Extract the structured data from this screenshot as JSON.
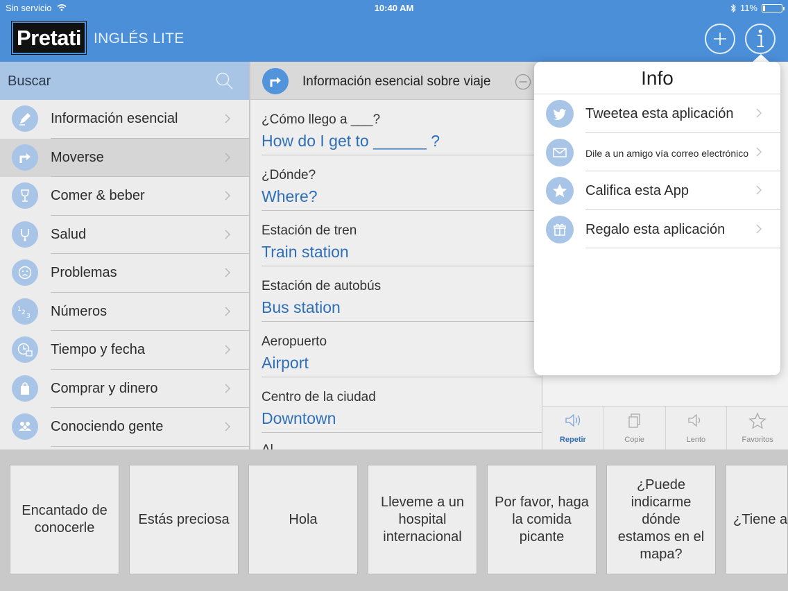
{
  "status_bar": {
    "carrier": "Sin servicio",
    "time": "10:40 AM",
    "battery": "11%",
    "battery_level": 0.11
  },
  "header": {
    "logo": "Pretati",
    "subtitle": "INGLÉS LITE"
  },
  "sidebar": {
    "search_label": "Buscar",
    "items": [
      {
        "label": "Información esencial",
        "icon": "pencil-icon",
        "selected": false
      },
      {
        "label": "Moverse",
        "icon": "turn-arrow-icon",
        "selected": true
      },
      {
        "label": "Comer & beber",
        "icon": "wine-glass-icon",
        "selected": false
      },
      {
        "label": "Salud",
        "icon": "stethoscope-icon",
        "selected": false
      },
      {
        "label": "Problemas",
        "icon": "sad-face-icon",
        "selected": false
      },
      {
        "label": "Números",
        "icon": "numbers-icon",
        "selected": false
      },
      {
        "label": "Tiempo y fecha",
        "icon": "clock-calendar-icon",
        "selected": false
      },
      {
        "label": "Comprar y dinero",
        "icon": "shopping-bag-icon",
        "selected": false
      },
      {
        "label": "Conociendo gente",
        "icon": "people-icon",
        "selected": false
      }
    ]
  },
  "middle": {
    "title": "Información esencial sobre viaje",
    "phrases": [
      {
        "source": "¿Cómo llego a ___?",
        "translation": "How do I get to ______ ?"
      },
      {
        "source": "¿Dónde?",
        "translation": "Where?"
      },
      {
        "source": "Estación de tren",
        "translation": "Train station"
      },
      {
        "source": "Estación de autobús",
        "translation": "Bus station"
      },
      {
        "source": "Aeropuerto",
        "translation": "Airport"
      },
      {
        "source": "Centro de la ciudad",
        "translation": "Downtown"
      }
    ],
    "partial_phrase": "Al..."
  },
  "actions": [
    {
      "label": "Repetir",
      "icon": "speaker-icon",
      "active": true
    },
    {
      "label": "Copie",
      "icon": "copy-icon",
      "active": false
    },
    {
      "label": "Lento",
      "icon": "speaker-slow-icon",
      "active": false
    },
    {
      "label": "Favoritos",
      "icon": "star-icon",
      "active": false
    }
  ],
  "popover": {
    "title": "Info",
    "items": [
      {
        "label": "Tweetea esta aplicación",
        "icon": "twitter-bird-icon"
      },
      {
        "label": "Dile a un amigo vía correo electrónico",
        "icon": "envelope-icon"
      },
      {
        "label": "Califica esta App",
        "icon": "star-icon"
      },
      {
        "label": "Regalo esta aplicación",
        "icon": "gift-icon"
      }
    ]
  },
  "tiles": [
    "Encantado de conocerle",
    "Estás preciosa",
    "Hola",
    "Lleveme a un hospital internacional",
    "Por favor, haga la comida picante",
    "¿Puede indicarme dónde estamos en el mapa?",
    "¿Tiene alguna habitación disponible?"
  ]
}
